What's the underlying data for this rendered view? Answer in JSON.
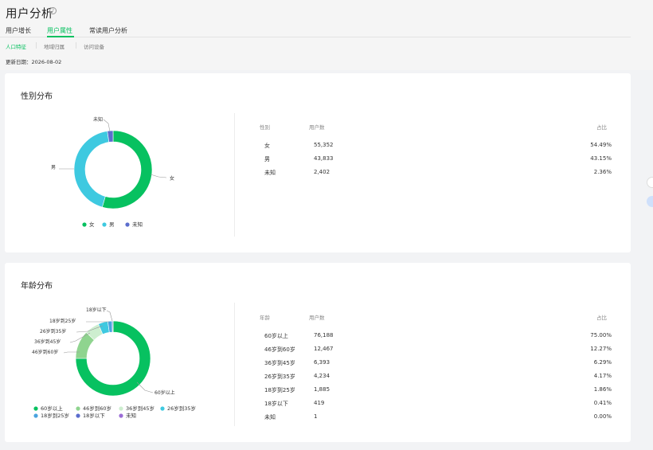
{
  "page": {
    "title": "用户分析",
    "help_icon": "?"
  },
  "tabs": [
    "用户增长",
    "用户属性",
    "常读用户分析"
  ],
  "subtabs": [
    "人口特征",
    "地域归属",
    "访问设备"
  ],
  "update": {
    "label": "更新日期：",
    "date": "2026-08-02"
  },
  "gender": {
    "title": "性别分布",
    "headers": {
      "name": "性别",
      "users": "用户数",
      "pct": "占比"
    }
  },
  "age": {
    "title": "年龄分布",
    "headers": {
      "name": "年龄",
      "users": "用户数",
      "pct": "占比"
    }
  },
  "chart_data": [
    {
      "type": "pie",
      "title": "性别分布",
      "labels": [
        "女",
        "男",
        "未知"
      ],
      "values": [
        55352,
        43833,
        2402
      ],
      "values_text": [
        "55,352",
        "43,833",
        "2,402"
      ],
      "percents": [
        "54.49%",
        "43.15%",
        "2.36%"
      ],
      "colors": [
        "#07c160",
        "#3ec9e0",
        "#5b6dcd"
      ],
      "legend": "bottom"
    },
    {
      "type": "pie",
      "title": "年龄分布",
      "labels": [
        "60岁以上",
        "46岁到60岁",
        "36岁到45岁",
        "26岁到35岁",
        "18岁到25岁",
        "18岁以下",
        "未知"
      ],
      "values": [
        76188,
        12467,
        6393,
        4234,
        1885,
        419,
        1
      ],
      "values_text": [
        "76,188",
        "12,467",
        "6,393",
        "4,234",
        "1,885",
        "419",
        "1"
      ],
      "percents": [
        "75.00%",
        "12.27%",
        "6.29%",
        "4.17%",
        "1.86%",
        "0.41%",
        "0.00%"
      ],
      "colors": [
        "#07c160",
        "#8fd48f",
        "#cdeecf",
        "#3ec9e0",
        "#4aa3df",
        "#5b6dcd",
        "#9b6dd6"
      ],
      "legend": "bottom"
    }
  ]
}
